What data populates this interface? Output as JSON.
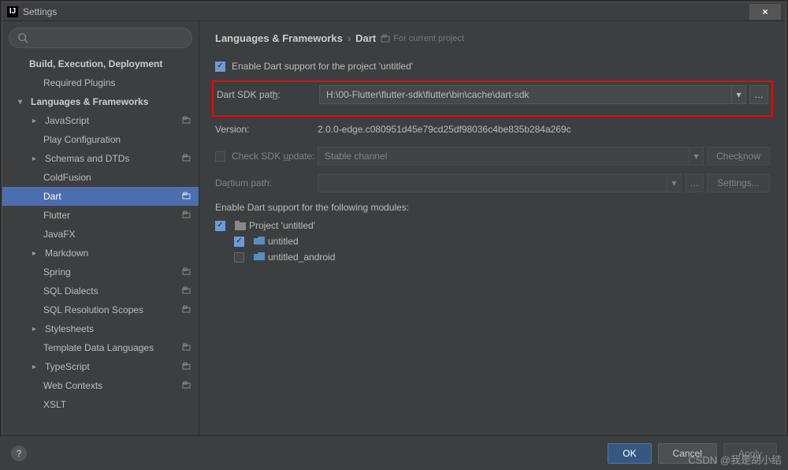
{
  "window": {
    "title": "Settings",
    "close": "×"
  },
  "breadcrumb": {
    "a": "Languages & Frameworks",
    "b": "Dart",
    "proj": "For current project"
  },
  "sidebar": {
    "items": [
      {
        "label": "Build, Execution, Deployment",
        "bold": true
      },
      {
        "label": "Required Plugins"
      },
      {
        "label": "Languages & Frameworks",
        "bold": true,
        "exp": true
      },
      {
        "label": "JavaScript",
        "col": true,
        "tag": ""
      },
      {
        "label": "Play Configuration"
      },
      {
        "label": "Schemas and DTDs",
        "col": true,
        "tag": ""
      },
      {
        "label": "ColdFusion"
      },
      {
        "label": "Dart",
        "sel": true,
        "tag": ""
      },
      {
        "label": "Flutter",
        "tag": ""
      },
      {
        "label": "JavaFX"
      },
      {
        "label": "Markdown",
        "col": true
      },
      {
        "label": "Spring",
        "tag": ""
      },
      {
        "label": "SQL Dialects",
        "tag": ""
      },
      {
        "label": "SQL Resolution Scopes",
        "tag": ""
      },
      {
        "label": "Stylesheets",
        "col": true
      },
      {
        "label": "Template Data Languages",
        "tag": ""
      },
      {
        "label": "TypeScript",
        "col": true,
        "tag": ""
      },
      {
        "label": "Web Contexts",
        "tag": ""
      },
      {
        "label": "XSLT"
      }
    ]
  },
  "enable": {
    "label": "Enable Dart support for the project 'untitled'"
  },
  "sdk": {
    "label": "Dart SDK path:",
    "value": "H:\\00-Flutter\\flutter-sdk\\flutter\\bin\\cache\\dart-sdk"
  },
  "version": {
    "label": "Version:",
    "value": "2.0.0-edge.c080951d45e79cd25df98036c4be835b284a269c"
  },
  "update": {
    "label": "Check SDK update:",
    "channel": "Stable channel",
    "btn": "Check now"
  },
  "dartium": {
    "label": "Dartium path:",
    "settings": "Settings..."
  },
  "modules": {
    "label": "Enable Dart support for the following modules:",
    "root": "Project 'untitled'",
    "items": [
      {
        "name": "untitled",
        "checked": true
      },
      {
        "name": "untitled_android",
        "checked": false
      }
    ]
  },
  "footer": {
    "ok": "OK",
    "cancel": "Cancel",
    "apply": "Apply"
  },
  "watermark": "CSDN @我是胡小结"
}
